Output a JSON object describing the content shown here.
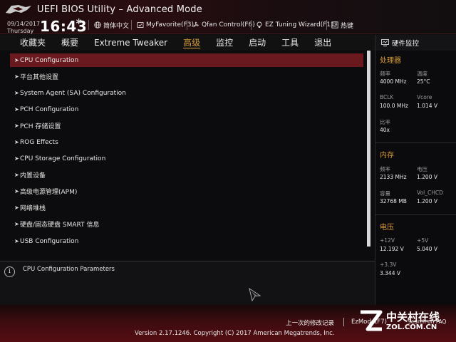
{
  "header": {
    "title": "UEFI BIOS Utility – Advanced Mode",
    "date": "09/14/2017",
    "weekday": "Thursday",
    "time": "16:43",
    "buttons": [
      {
        "label": "简体中文",
        "icon": "globe-icon"
      },
      {
        "label": "MyFavorite(F3)",
        "icon": "favorite-icon"
      },
      {
        "label": "Qfan Control(F6)",
        "icon": "fan-icon"
      },
      {
        "label": "EZ Tuning Wizard(F11)",
        "icon": "bulb-icon"
      },
      {
        "label": "热键",
        "icon": "help-icon"
      }
    ]
  },
  "tabs": [
    {
      "label": "收藏夹",
      "active": false
    },
    {
      "label": "概要",
      "active": false
    },
    {
      "label": "Extreme Tweaker",
      "active": false
    },
    {
      "label": "高级",
      "active": true
    },
    {
      "label": "监控",
      "active": false
    },
    {
      "label": "启动",
      "active": false
    },
    {
      "label": "工具",
      "active": false
    },
    {
      "label": "退出",
      "active": false
    }
  ],
  "menu": [
    "CPU Configuration",
    "平台其他设置",
    "System Agent (SA) Configuration",
    "PCH Configuration",
    "PCH 存储设置",
    "ROG Effects",
    "CPU Storage Configuration",
    "内置设备",
    "高级电源管理(APM)",
    "网络堆栈",
    "硬盘/固态硬盘 SMART 信息",
    "USB Configuration"
  ],
  "selected_index": 0,
  "info": {
    "text": "CPU Configuration Parameters"
  },
  "hw_monitor": {
    "title": "硬件监控",
    "cpu": {
      "section": "处理器",
      "freq_label": "频率",
      "freq_value": "4000 MHz",
      "temp_label": "温度",
      "temp_value": "25°C",
      "bclk_label": "BCLK",
      "bclk_value": "100.0 MHz",
      "vcore_label": "Vcore",
      "vcore_value": "1.014 V",
      "ratio_label": "比率",
      "ratio_value": "40x"
    },
    "memory": {
      "section": "内存",
      "freq_label": "频率",
      "freq_value": "2133 MHz",
      "volt_label": "电压",
      "volt_value": "1.200 V",
      "cap_label": "容量",
      "cap_value": "32768 MB",
      "vchcd_label": "Vol_CHCD",
      "vchcd_value": "1.200 V"
    },
    "voltage": {
      "section": "电压",
      "v12_label": "+12V",
      "v12_value": "12.192 V",
      "v5_label": "+5V",
      "v5_value": "5.040 V",
      "v33_label": "+3.3V",
      "v33_value": "3.344 V"
    }
  },
  "footer": {
    "last_modified": "上一次的修改记录",
    "ezmode": "EzMode(F7)",
    "search_faq": "Search on FAQ",
    "copyright": "Version 2.17.1246. Copyright (C) 2017 American Megatrends, Inc."
  },
  "watermark": {
    "cn": "中关村在线",
    "en": "ZOL.COM.CN"
  },
  "colors": {
    "accent": "#d89b3c",
    "selected_row": "#6a1a1e",
    "background": "#0e0e10"
  }
}
